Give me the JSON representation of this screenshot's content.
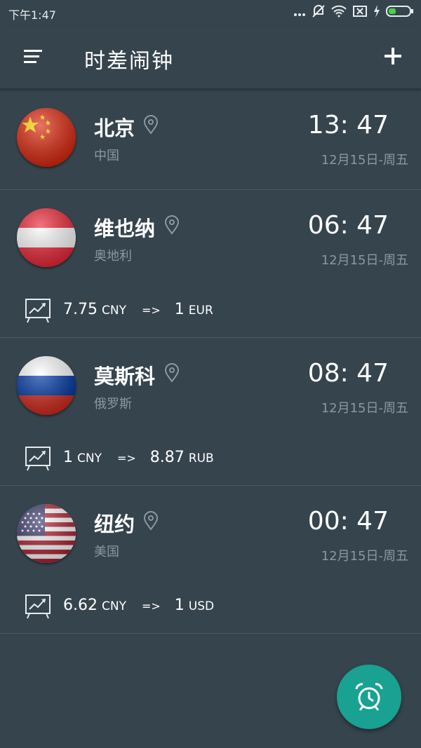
{
  "status_bar": {
    "time": "下午1:47",
    "icons": [
      "more-dots-icon",
      "mute-icon",
      "wifi-icon",
      "sim-x-icon",
      "charging-icon",
      "battery-icon"
    ]
  },
  "toolbar": {
    "title": "时差闹钟",
    "menu_icon": "menu-icon",
    "add_icon": "add-icon"
  },
  "cities": [
    {
      "name": "北京",
      "country": "中国",
      "time": "13: 47",
      "date": "12月15日-周五",
      "flag": "china-flag-icon",
      "rate": null
    },
    {
      "name": "维也纳",
      "country": "奥地利",
      "time": "06: 47",
      "date": "12月15日-周五",
      "flag": "austria-flag-icon",
      "rate": {
        "left_amount": "7.75",
        "left_currency": "CNY",
        "arrow": "=>",
        "right_amount": "1",
        "right_currency": "EUR"
      }
    },
    {
      "name": "莫斯科",
      "country": "俄罗斯",
      "time": "08: 47",
      "date": "12月15日-周五",
      "flag": "russia-flag-icon",
      "rate": {
        "left_amount": "1",
        "left_currency": "CNY",
        "arrow": "=>",
        "right_amount": "8.87",
        "right_currency": "RUB"
      }
    },
    {
      "name": "纽约",
      "country": "美国",
      "time": "00: 47",
      "date": "12月15日-周五",
      "flag": "usa-flag-icon",
      "rate": {
        "left_amount": "6.62",
        "left_currency": "CNY",
        "arrow": "=>",
        "right_amount": "1",
        "right_currency": "USD"
      }
    }
  ],
  "fab": {
    "icon": "alarm-clock-icon"
  },
  "colors": {
    "background": "#36444d",
    "fab": "#19a192",
    "muted_text": "#8a98a1"
  }
}
